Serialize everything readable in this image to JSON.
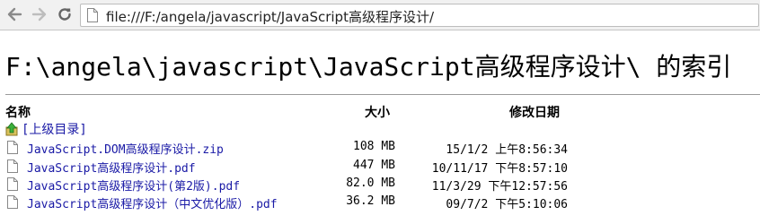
{
  "browser": {
    "url": "file:///F:/angela/javascript/JavaScript高级程序设计/",
    "back_icon": "arrow-left-icon",
    "forward_icon": "arrow-right-icon",
    "reload_icon": "reload-icon",
    "page_icon": "page-icon"
  },
  "page": {
    "title": "F:\\angela\\javascript\\JavaScript高级程序设计\\ 的索引"
  },
  "table": {
    "headers": {
      "name": "名称",
      "size": "大小",
      "modified": "修改日期"
    },
    "parent_link": "[上级目录]",
    "rows": [
      {
        "name": "JavaScript.DOM高级程序设计.zip",
        "size": "108 MB",
        "modified": "15/1/2 上午8:56:34"
      },
      {
        "name": "JavaScript高级程序设计.pdf",
        "size": "447 MB",
        "modified": "10/11/17 下午8:57:10"
      },
      {
        "name": "JavaScript高级程序设计(第2版).pdf",
        "size": "82.0 MB",
        "modified": "11/3/29 下午12:57:56"
      },
      {
        "name": "JavaScript高级程序设计（中文优化版）.pdf",
        "size": "36.2 MB",
        "modified": "09/7/2 下午5:10:06"
      }
    ]
  },
  "colors": {
    "link": "#1a1aa6",
    "toolbar_bg": "#f1f1f1",
    "up_arrow": "#e8b020"
  }
}
